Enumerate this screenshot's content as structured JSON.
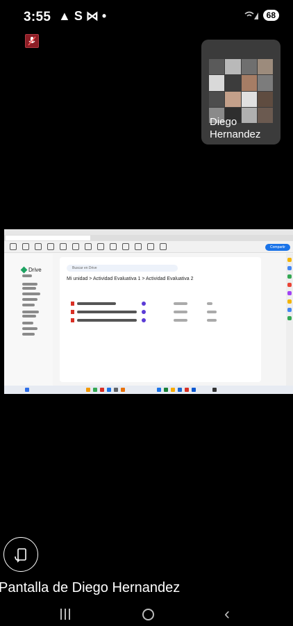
{
  "status_bar": {
    "time": "3:55",
    "notification_icons": "▲ S ⋈ •",
    "battery": "68",
    "signal_icon": "wifi-signal-icon"
  },
  "meeting": {
    "mic_state_icon": "mic-muted-icon",
    "participant": {
      "name": "Diego\nHernandez"
    },
    "caption": "Pantalla de Diego Hernandez"
  },
  "shared_screen": {
    "app": "Google Drive",
    "share_button": "Compartir",
    "search_placeholder": "Buscar en Drive",
    "breadcrumb": "Mi unidad  >  Actividad Evaluativa 1  >  Actividad Evaluativa 2",
    "logo_label": "Drive"
  },
  "navigation": {
    "recents_icon": "recents-icon",
    "home_icon": "home-icon",
    "back_icon": "back-icon"
  }
}
